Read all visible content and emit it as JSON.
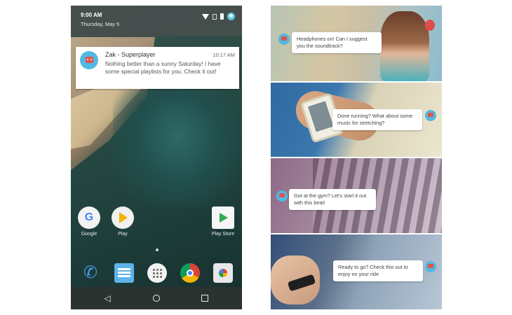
{
  "status_bar": {
    "time": "9:00 AM",
    "date": "Thursday, May 5",
    "icons": [
      "wifi-icon",
      "no-sim-icon",
      "battery-icon",
      "account-icon"
    ]
  },
  "notification": {
    "app_name": "Zak - Superplayer",
    "time": "10:17 AM",
    "body": "Nothing better than a sunny Saturday! I have some special playlists for you. Check it out!"
  },
  "home_apps": [
    {
      "label": "Google",
      "icon": "google-icon"
    },
    {
      "label": "Play",
      "icon": "play-icon"
    },
    {
      "label": "Play Store",
      "icon": "play-store-icon"
    }
  ],
  "dock": [
    "phone-icon",
    "messages-icon",
    "app-drawer-icon",
    "chrome-icon",
    "camera-icon"
  ],
  "nav": [
    "back-icon",
    "home-icon",
    "recents-icon"
  ],
  "chat_messages": [
    {
      "text": "Headphones on! Can I suggest you the soundtrack?"
    },
    {
      "text": "Done running? What about some music for stretching?"
    },
    {
      "text": "Got at the gym? Let's start it out with this beat!"
    },
    {
      "text": "Ready to go? Check this out to enjoy on your ride"
    }
  ],
  "colors": {
    "accent": "#4fb9e2",
    "robot": "#e3524c"
  }
}
